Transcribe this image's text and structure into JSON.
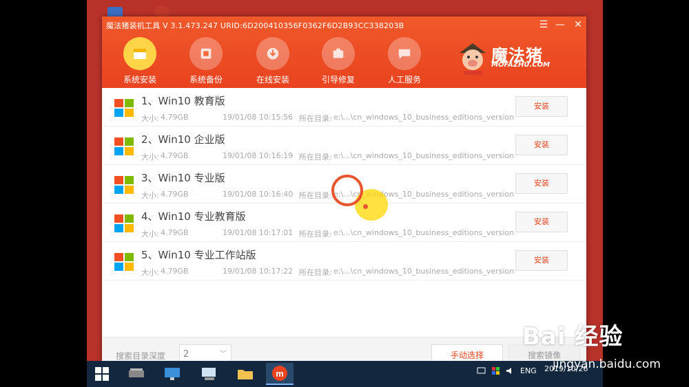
{
  "window": {
    "title": "魔法猪装机工具 V 3.1.473.247 URID:6D200410356F0362F6D2B93CC338203B",
    "menu_icon": "hamburger-menu-icon",
    "minimize_icon": "minimize-icon",
    "close_icon": "close-icon"
  },
  "nav": [
    {
      "label": "系统安装",
      "icon": "system-install-icon",
      "active": true
    },
    {
      "label": "系统备份",
      "icon": "backup-icon",
      "active": false
    },
    {
      "label": "在线安装",
      "icon": "online-install-icon",
      "active": false
    },
    {
      "label": "引导修复",
      "icon": "boot-repair-icon",
      "active": false
    },
    {
      "label": "人工服务",
      "icon": "chat-service-icon",
      "active": false
    }
  ],
  "brand": {
    "name": "魔法猪",
    "sub": "MOFAZHU.COM"
  },
  "list": {
    "size_prefix": "大小:",
    "path_prefix": "所在目录:",
    "install_label": "安装",
    "items": [
      {
        "title": "1、Win10 教育版",
        "size": "4.79GB",
        "date": "19/01/08 10:15:56",
        "path": "e:\\...\\cn_windows_10_business_editions_version"
      },
      {
        "title": "2、Win10 企业版",
        "size": "4.79GB",
        "date": "19/01/08 10:16:19",
        "path": "e:\\...\\cn_windows_10_business_editions_version"
      },
      {
        "title": "3、Win10 专业版",
        "size": "4.79GB",
        "date": "19/01/08 10:16:40",
        "path": "e:\\...\\cn_windows_10_business_editions_version"
      },
      {
        "title": "4、Win10 专业教育版",
        "size": "4.79GB",
        "date": "19/01/08 10:17:01",
        "path": "e:\\...\\cn_windows_10_business_editions_version"
      },
      {
        "title": "5、Win10 专业工作站版",
        "size": "4.79GB",
        "date": "19/01/08 10:17:22",
        "path": "e:\\...\\cn_windows_10_business_editions_version"
      }
    ]
  },
  "bottom": {
    "depth_label": "搜索目录深度",
    "depth_value": "2",
    "manual_label": "手动选择",
    "search_label": "搜索镜像"
  },
  "taskbar": {
    "lang": "ENG",
    "time": "",
    "date": "2019/10/26"
  },
  "watermark": {
    "main": "Bai 经验",
    "url": "jingyan.baidu.com"
  },
  "colors": {
    "brand_orange": "#e9431f",
    "active_nav": "#ffd447",
    "desktop": "#b8322a",
    "taskbar": "#13283f"
  }
}
